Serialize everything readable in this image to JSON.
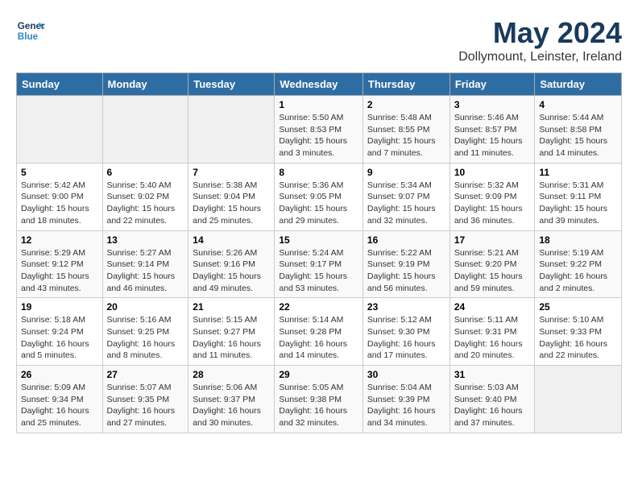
{
  "header": {
    "logo_line1": "General",
    "logo_line2": "Blue",
    "month_title": "May 2024",
    "location": "Dollymount, Leinster, Ireland"
  },
  "weekdays": [
    "Sunday",
    "Monday",
    "Tuesday",
    "Wednesday",
    "Thursday",
    "Friday",
    "Saturday"
  ],
  "weeks": [
    [
      {
        "day": "",
        "info": ""
      },
      {
        "day": "",
        "info": ""
      },
      {
        "day": "",
        "info": ""
      },
      {
        "day": "1",
        "info": "Sunrise: 5:50 AM\nSunset: 8:53 PM\nDaylight: 15 hours\nand 3 minutes."
      },
      {
        "day": "2",
        "info": "Sunrise: 5:48 AM\nSunset: 8:55 PM\nDaylight: 15 hours\nand 7 minutes."
      },
      {
        "day": "3",
        "info": "Sunrise: 5:46 AM\nSunset: 8:57 PM\nDaylight: 15 hours\nand 11 minutes."
      },
      {
        "day": "4",
        "info": "Sunrise: 5:44 AM\nSunset: 8:58 PM\nDaylight: 15 hours\nand 14 minutes."
      }
    ],
    [
      {
        "day": "5",
        "info": "Sunrise: 5:42 AM\nSunset: 9:00 PM\nDaylight: 15 hours\nand 18 minutes."
      },
      {
        "day": "6",
        "info": "Sunrise: 5:40 AM\nSunset: 9:02 PM\nDaylight: 15 hours\nand 22 minutes."
      },
      {
        "day": "7",
        "info": "Sunrise: 5:38 AM\nSunset: 9:04 PM\nDaylight: 15 hours\nand 25 minutes."
      },
      {
        "day": "8",
        "info": "Sunrise: 5:36 AM\nSunset: 9:05 PM\nDaylight: 15 hours\nand 29 minutes."
      },
      {
        "day": "9",
        "info": "Sunrise: 5:34 AM\nSunset: 9:07 PM\nDaylight: 15 hours\nand 32 minutes."
      },
      {
        "day": "10",
        "info": "Sunrise: 5:32 AM\nSunset: 9:09 PM\nDaylight: 15 hours\nand 36 minutes."
      },
      {
        "day": "11",
        "info": "Sunrise: 5:31 AM\nSunset: 9:11 PM\nDaylight: 15 hours\nand 39 minutes."
      }
    ],
    [
      {
        "day": "12",
        "info": "Sunrise: 5:29 AM\nSunset: 9:12 PM\nDaylight: 15 hours\nand 43 minutes."
      },
      {
        "day": "13",
        "info": "Sunrise: 5:27 AM\nSunset: 9:14 PM\nDaylight: 15 hours\nand 46 minutes."
      },
      {
        "day": "14",
        "info": "Sunrise: 5:26 AM\nSunset: 9:16 PM\nDaylight: 15 hours\nand 49 minutes."
      },
      {
        "day": "15",
        "info": "Sunrise: 5:24 AM\nSunset: 9:17 PM\nDaylight: 15 hours\nand 53 minutes."
      },
      {
        "day": "16",
        "info": "Sunrise: 5:22 AM\nSunset: 9:19 PM\nDaylight: 15 hours\nand 56 minutes."
      },
      {
        "day": "17",
        "info": "Sunrise: 5:21 AM\nSunset: 9:20 PM\nDaylight: 15 hours\nand 59 minutes."
      },
      {
        "day": "18",
        "info": "Sunrise: 5:19 AM\nSunset: 9:22 PM\nDaylight: 16 hours\nand 2 minutes."
      }
    ],
    [
      {
        "day": "19",
        "info": "Sunrise: 5:18 AM\nSunset: 9:24 PM\nDaylight: 16 hours\nand 5 minutes."
      },
      {
        "day": "20",
        "info": "Sunrise: 5:16 AM\nSunset: 9:25 PM\nDaylight: 16 hours\nand 8 minutes."
      },
      {
        "day": "21",
        "info": "Sunrise: 5:15 AM\nSunset: 9:27 PM\nDaylight: 16 hours\nand 11 minutes."
      },
      {
        "day": "22",
        "info": "Sunrise: 5:14 AM\nSunset: 9:28 PM\nDaylight: 16 hours\nand 14 minutes."
      },
      {
        "day": "23",
        "info": "Sunrise: 5:12 AM\nSunset: 9:30 PM\nDaylight: 16 hours\nand 17 minutes."
      },
      {
        "day": "24",
        "info": "Sunrise: 5:11 AM\nSunset: 9:31 PM\nDaylight: 16 hours\nand 20 minutes."
      },
      {
        "day": "25",
        "info": "Sunrise: 5:10 AM\nSunset: 9:33 PM\nDaylight: 16 hours\nand 22 minutes."
      }
    ],
    [
      {
        "day": "26",
        "info": "Sunrise: 5:09 AM\nSunset: 9:34 PM\nDaylight: 16 hours\nand 25 minutes."
      },
      {
        "day": "27",
        "info": "Sunrise: 5:07 AM\nSunset: 9:35 PM\nDaylight: 16 hours\nand 27 minutes."
      },
      {
        "day": "28",
        "info": "Sunrise: 5:06 AM\nSunset: 9:37 PM\nDaylight: 16 hours\nand 30 minutes."
      },
      {
        "day": "29",
        "info": "Sunrise: 5:05 AM\nSunset: 9:38 PM\nDaylight: 16 hours\nand 32 minutes."
      },
      {
        "day": "30",
        "info": "Sunrise: 5:04 AM\nSunset: 9:39 PM\nDaylight: 16 hours\nand 34 minutes."
      },
      {
        "day": "31",
        "info": "Sunrise: 5:03 AM\nSunset: 9:40 PM\nDaylight: 16 hours\nand 37 minutes."
      },
      {
        "day": "",
        "info": ""
      }
    ]
  ]
}
